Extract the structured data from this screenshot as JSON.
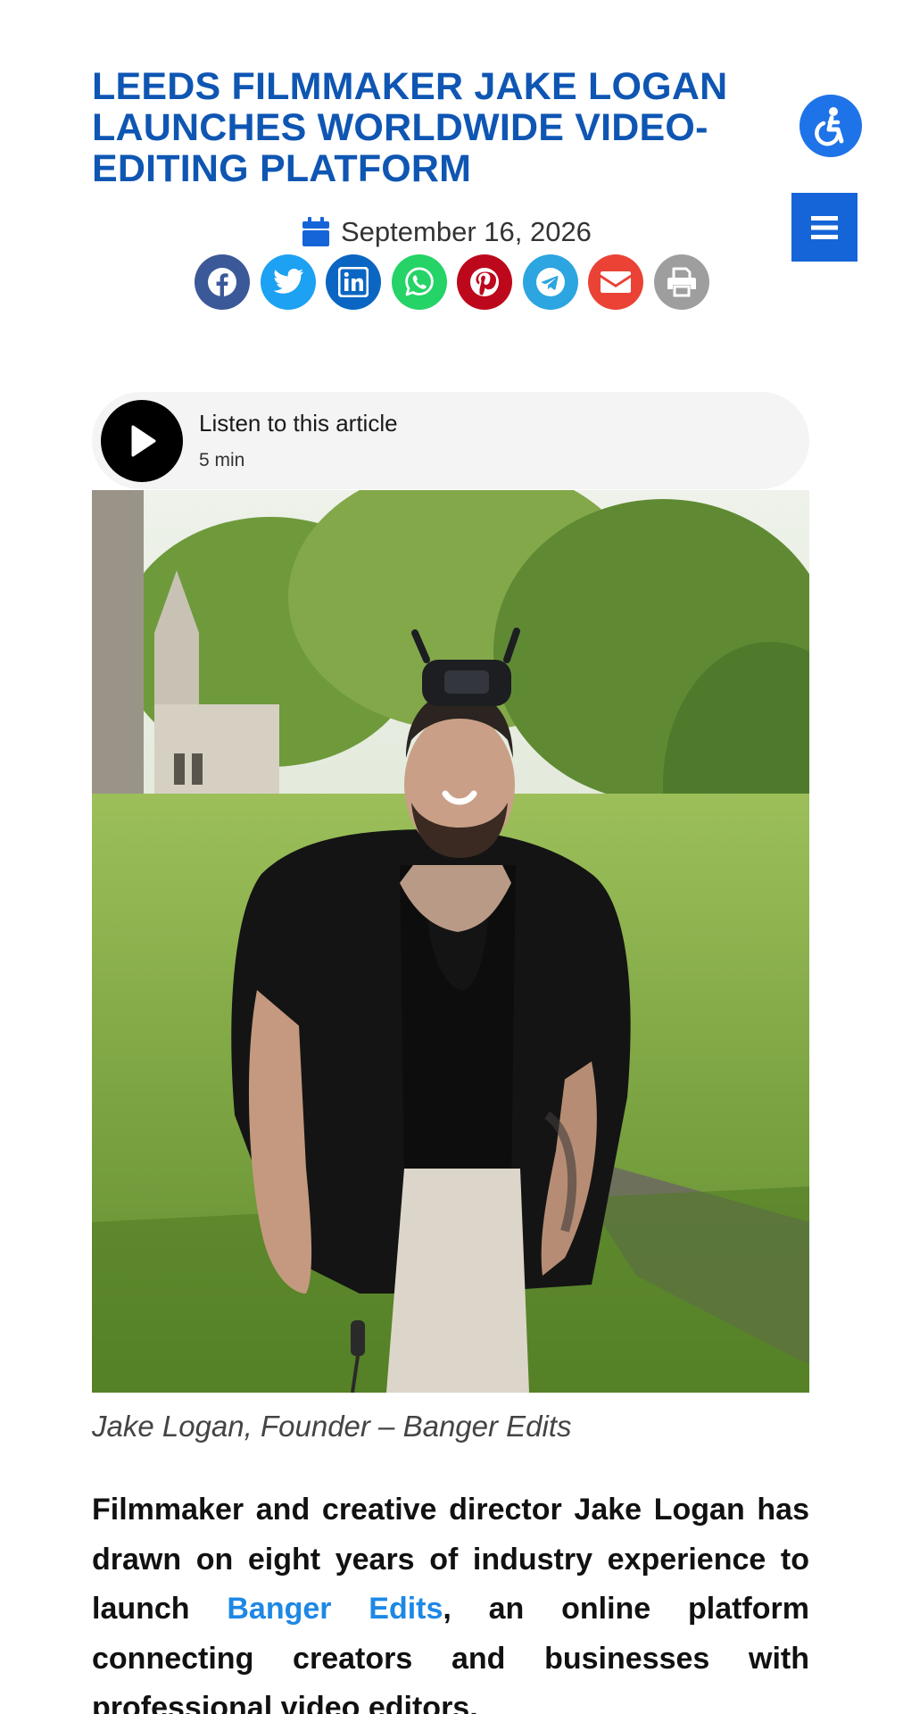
{
  "article": {
    "title": "LEEDS FILMMAKER JAKE LOGAN LAUNCHES WORLDWIDE VIDEO-EDITING PLATFORM",
    "date": "September 16, 2026",
    "caption": "Jake Logan, Founder – Banger Edits",
    "body_before_link": "Filmmaker and creative director Jake Logan has drawn on eight years of industry experience to launch ",
    "body_link": "Banger Edits",
    "body_after_link": ", an online platform connecting creators and businesses with professional video editors."
  },
  "header": {
    "accessibility_icon": "accessibility-icon",
    "menu_icon": "hamburger-menu-icon"
  },
  "share": {
    "buttons": [
      {
        "icon": "facebook-icon",
        "color": "#3b5998"
      },
      {
        "icon": "twitter-icon",
        "color": "#1da1f2"
      },
      {
        "icon": "linkedin-icon",
        "color": "#0a66c2"
      },
      {
        "icon": "whatsapp-icon",
        "color": "#25d366"
      },
      {
        "icon": "pinterest-icon",
        "color": "#bd081c"
      },
      {
        "icon": "telegram-icon",
        "color": "#2ca5e0"
      },
      {
        "icon": "email-icon",
        "color": "#ea4335"
      },
      {
        "icon": "print-icon",
        "color": "#9e9e9e"
      }
    ]
  },
  "audio_player": {
    "label": "Listen to this article",
    "duration": "5 min"
  },
  "colors": {
    "title": "#0f56b3",
    "accent": "#1e73e8",
    "link": "#1e88e5"
  }
}
